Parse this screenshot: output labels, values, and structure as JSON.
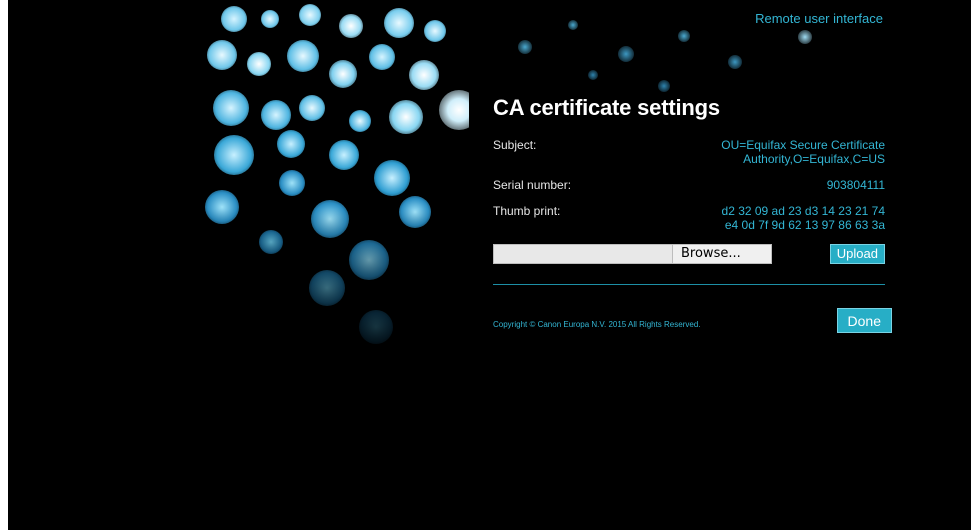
{
  "header": {
    "link_label": "Remote user interface"
  },
  "page": {
    "title": "CA certificate settings"
  },
  "certificate": {
    "subject_label": "Subject:",
    "subject_line1": "OU=Equifax Secure Certificate",
    "subject_line2": "Authority,O=Equifax,C=US",
    "serial_label": "Serial number:",
    "serial_value": "903804111",
    "thumb_label": "Thumb print:",
    "thumb_line1": "d2 32 09 ad 23 d3 14 23 21 74",
    "thumb_line2": "e4 0d 7f 9d 62 13 97 86 63 3a"
  },
  "upload": {
    "file_value": "",
    "browse_label": "Browse...",
    "upload_label": "Upload"
  },
  "footer": {
    "copyright": "Copyright © Canon Europa N.V. 2015 All Rights Reserved.",
    "done_label": "Done"
  },
  "colors": {
    "accent": "#33b6d4",
    "button_bg": "#27aec6",
    "background": "#000000"
  }
}
